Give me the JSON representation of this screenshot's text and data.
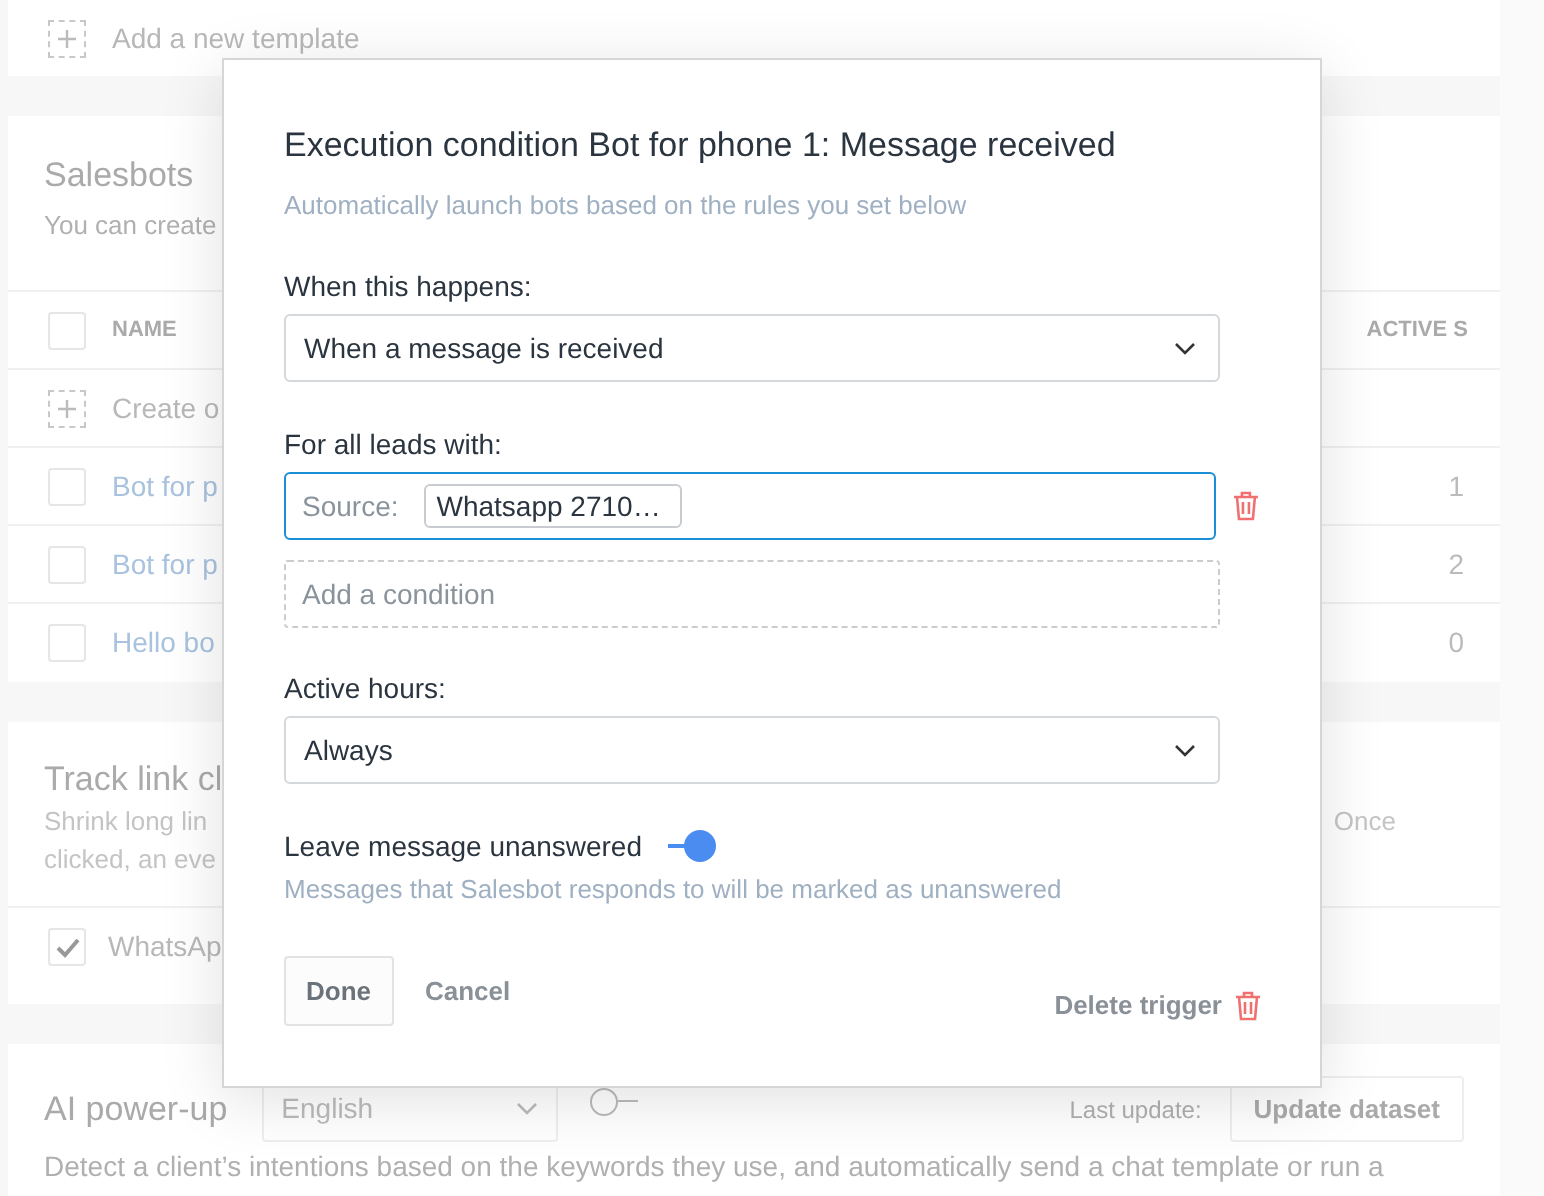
{
  "templates": {
    "add_label": "Add a new template"
  },
  "salesbots": {
    "title": "Salesbots",
    "description": "You can create",
    "all_checked": false,
    "columns": [
      "NAME",
      "ACTIVE S"
    ],
    "create_label": "Create o",
    "rows": [
      {
        "name": "Bot for p",
        "active": "1",
        "checked": false
      },
      {
        "name": "Bot for p",
        "active": "2",
        "checked": false
      },
      {
        "name": "Hello bo",
        "active": "0",
        "checked": false
      }
    ]
  },
  "track_links": {
    "title": "Track link cl",
    "description_lines": [
      "Shrink long lin",
      "clicked, an eve"
    ],
    "description_end": "Once",
    "items": [
      {
        "label": "WhatsAp",
        "checked": true
      }
    ]
  },
  "ai_powerup": {
    "title": "AI power-up",
    "language": "English",
    "on": false,
    "last_update_label": "Last update:",
    "update_button": "Update dataset",
    "description": "Detect a client’s intentions based on the keywords they use, and automatically send a chat template or run a"
  },
  "modal": {
    "title": "Execution condition Bot for phone 1: Message received",
    "subtitle": "Automatically launch bots based on the rules you set below",
    "trigger": {
      "label": "When this happens:",
      "value": "When a message is received"
    },
    "leads": {
      "label": "For all leads with:",
      "conditions": [
        {
          "label": "Source:",
          "value": "Whatsapp 2710…"
        }
      ],
      "add_placeholder": "Add a condition"
    },
    "hours": {
      "label": "Active hours:",
      "value": "Always"
    },
    "unanswered": {
      "label": "Leave message unanswered",
      "on": true,
      "hint": "Messages that Salesbot responds to will be marked as unanswered"
    },
    "done_button": "Done",
    "cancel_button": "Cancel",
    "delete_button": "Delete trigger"
  }
}
